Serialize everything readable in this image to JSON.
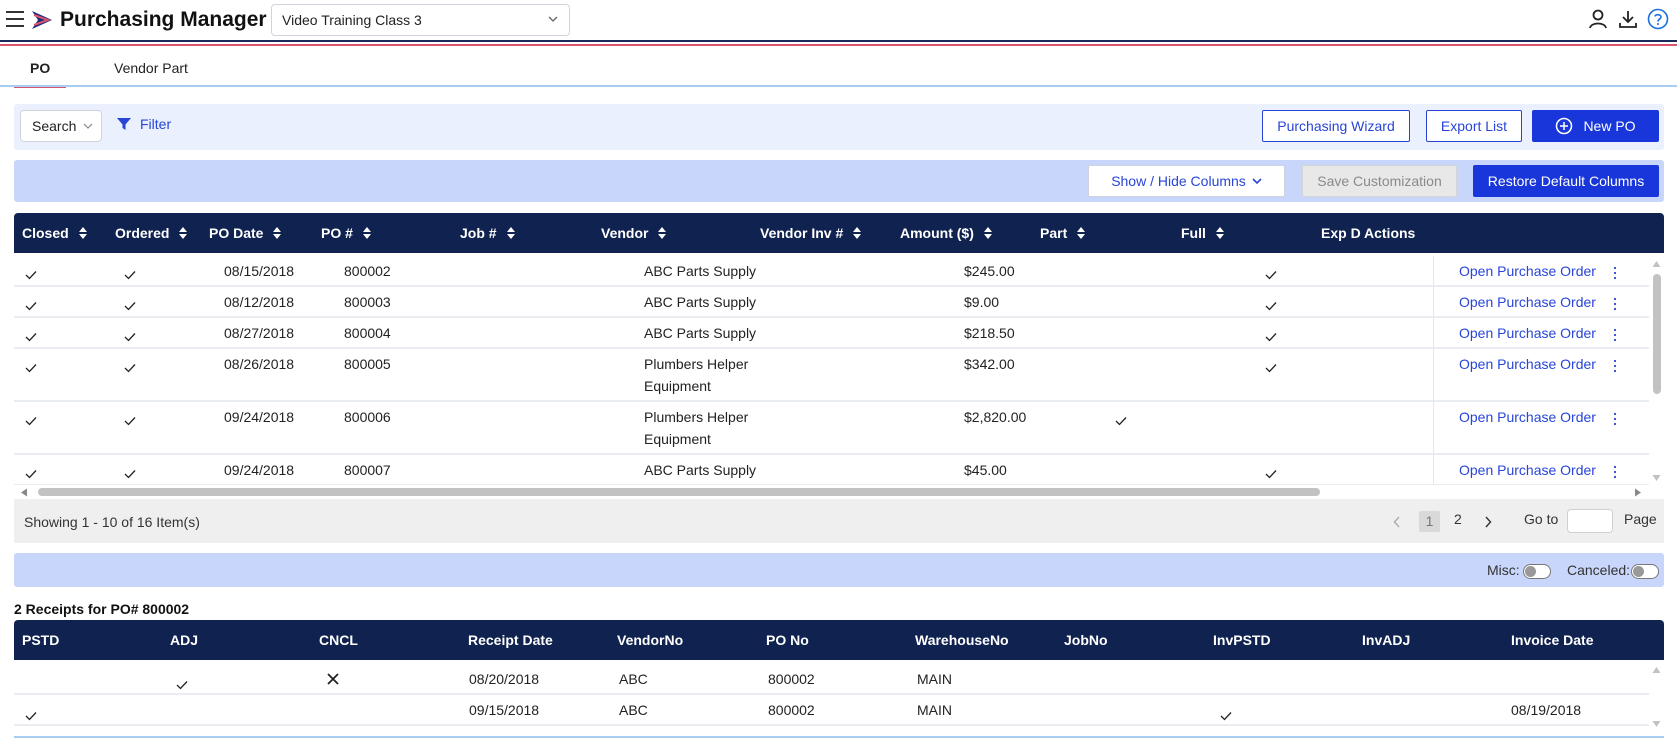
{
  "header": {
    "app_title": "Purchasing Manager",
    "company": "Video Training Class 3",
    "icons": [
      "menu-icon",
      "logo-flag",
      "user-icon",
      "download-icon",
      "help-icon"
    ]
  },
  "tabs": [
    {
      "label": "PO",
      "active": true
    },
    {
      "label": "Vendor Part",
      "active": false
    }
  ],
  "toolbar": {
    "search_label": "Search",
    "filter_label": "Filter",
    "wizard_label": "Purchasing Wizard",
    "export_label": "Export List",
    "new_po_label": "New PO"
  },
  "columns_bar": {
    "show_hide_label": "Show / Hide Columns",
    "save_label": "Save Customization",
    "restore_label": "Restore Default Columns"
  },
  "po_grid": {
    "columns": [
      "Closed",
      "Ordered",
      "PO Date",
      "PO #",
      "Job #",
      "Vendor",
      "Vendor Inv #",
      "Amount ($)",
      "Part",
      "Full",
      "Exp D",
      "Actions"
    ],
    "action_label": "Open Purchase Order",
    "rows": [
      {
        "closed": true,
        "ordered": true,
        "po_date": "08/15/2018",
        "po_no": "800002",
        "job": "",
        "vendor_line1": "ABC Parts Supply",
        "vendor_line2": "",
        "vendor_inv": "",
        "amount": "$245.00",
        "part": false,
        "full": true
      },
      {
        "closed": true,
        "ordered": true,
        "po_date": "08/12/2018",
        "po_no": "800003",
        "job": "",
        "vendor_line1": "ABC Parts Supply",
        "vendor_line2": "",
        "vendor_inv": "",
        "amount": "$9.00",
        "part": false,
        "full": true
      },
      {
        "closed": true,
        "ordered": true,
        "po_date": "08/27/2018",
        "po_no": "800004",
        "job": "",
        "vendor_line1": "ABC Parts Supply",
        "vendor_line2": "",
        "vendor_inv": "",
        "amount": "$218.50",
        "part": false,
        "full": true
      },
      {
        "closed": true,
        "ordered": true,
        "po_date": "08/26/2018",
        "po_no": "800005",
        "job": "",
        "vendor_line1": "Plumbers Helper",
        "vendor_line2": "Equipment",
        "vendor_inv": "",
        "amount": "$342.00",
        "part": false,
        "full": true
      },
      {
        "closed": true,
        "ordered": true,
        "po_date": "09/24/2018",
        "po_no": "800006",
        "job": "",
        "vendor_line1": "Plumbers Helper",
        "vendor_line2": "Equipment",
        "vendor_inv": "",
        "amount": "$2,820.00",
        "part": true,
        "full": false
      },
      {
        "closed": true,
        "ordered": true,
        "po_date": "09/24/2018",
        "po_no": "800007",
        "job": "",
        "vendor_line1": "ABC Parts Supply",
        "vendor_line2": "",
        "vendor_inv": "",
        "amount": "$45.00",
        "part": false,
        "full": true
      }
    ]
  },
  "pager": {
    "showing": "Showing 1 - 10 of 16 Item(s)",
    "current_page": "1",
    "next_page": "2",
    "goto_label": "Go to",
    "page_label": "Page"
  },
  "misc_bar": {
    "misc_label": "Misc:",
    "misc_on": false,
    "canceled_label": "Canceled:",
    "canceled_on": false
  },
  "receipts": {
    "title": "2 Receipts for PO# 800002",
    "columns": [
      "PSTD",
      "ADJ",
      "CNCL",
      "Receipt Date",
      "VendorNo",
      "PO No",
      "WarehouseNo",
      "JobNo",
      "InvPSTD",
      "InvADJ",
      "Invoice Date"
    ],
    "rows": [
      {
        "pstd": false,
        "adj": true,
        "cncl": true,
        "receipt_date": "08/20/2018",
        "vendor_no": "ABC",
        "po_no": "800002",
        "warehouse": "MAIN",
        "job_no": "",
        "inv_pstd": false,
        "inv_adj": false,
        "invoice_date": ""
      },
      {
        "pstd": true,
        "adj": false,
        "cncl": false,
        "receipt_date": "09/15/2018",
        "vendor_no": "ABC",
        "po_no": "800002",
        "warehouse": "MAIN",
        "job_no": "",
        "inv_pstd": true,
        "inv_adj": false,
        "invoice_date": "08/19/2018"
      }
    ]
  },
  "colors": {
    "navy": "#10224f",
    "accent_blue": "#1836d9",
    "link_blue": "#2845d6",
    "tab_pink": "#d9546e",
    "light_band": "#c9d6fb"
  }
}
